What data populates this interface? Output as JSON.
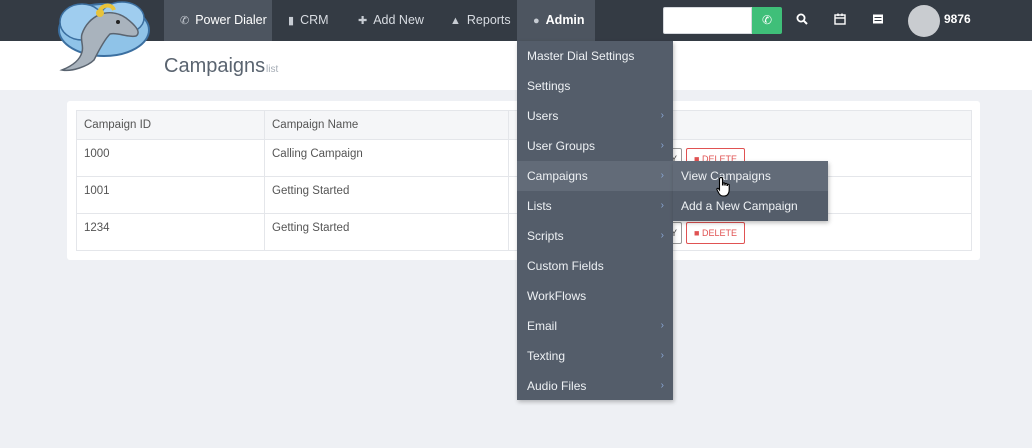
{
  "nav": {
    "items": [
      {
        "label": "Power Dialer",
        "icon": "phone-icon"
      },
      {
        "label": "CRM",
        "icon": "book-icon"
      },
      {
        "label": "Add New",
        "icon": "plus-icon"
      },
      {
        "label": "Reports",
        "icon": "flask-icon"
      },
      {
        "label": "Admin",
        "icon": "user-icon"
      }
    ],
    "user_name": "9876"
  },
  "header": {
    "title": "Campaigns",
    "subtitle": "list"
  },
  "table": {
    "columns": [
      "Campaign ID",
      "Campaign Name"
    ],
    "rows": [
      {
        "id": "1000",
        "name": "Calling Campaign"
      },
      {
        "id": "1001",
        "name": "Getting Started"
      },
      {
        "id": "1234",
        "name": "Getting Started"
      }
    ],
    "delete_label": "DELETE",
    "partial_btn_label": "Y"
  },
  "admin_menu": {
    "items": [
      {
        "label": "Master Dial Settings",
        "has_sub": false
      },
      {
        "label": "Settings",
        "has_sub": false
      },
      {
        "label": "Users",
        "has_sub": true
      },
      {
        "label": "User Groups",
        "has_sub": true
      },
      {
        "label": "Campaigns",
        "has_sub": true
      },
      {
        "label": "Lists",
        "has_sub": true
      },
      {
        "label": "Scripts",
        "has_sub": true
      },
      {
        "label": "Custom Fields",
        "has_sub": false
      },
      {
        "label": "WorkFlows",
        "has_sub": false
      },
      {
        "label": "Email",
        "has_sub": true
      },
      {
        "label": "Texting",
        "has_sub": true
      },
      {
        "label": "Audio Files",
        "has_sub": true
      }
    ],
    "hovered": "Campaigns"
  },
  "campaigns_submenu": {
    "items": [
      "View Campaigns",
      "Add a New Campaign"
    ],
    "hovered": "View Campaigns"
  },
  "colors": {
    "topbar": "#343b44",
    "dial_button": "#3fbf79",
    "menu_bg": "#545d6a",
    "delete": "#e05252"
  }
}
